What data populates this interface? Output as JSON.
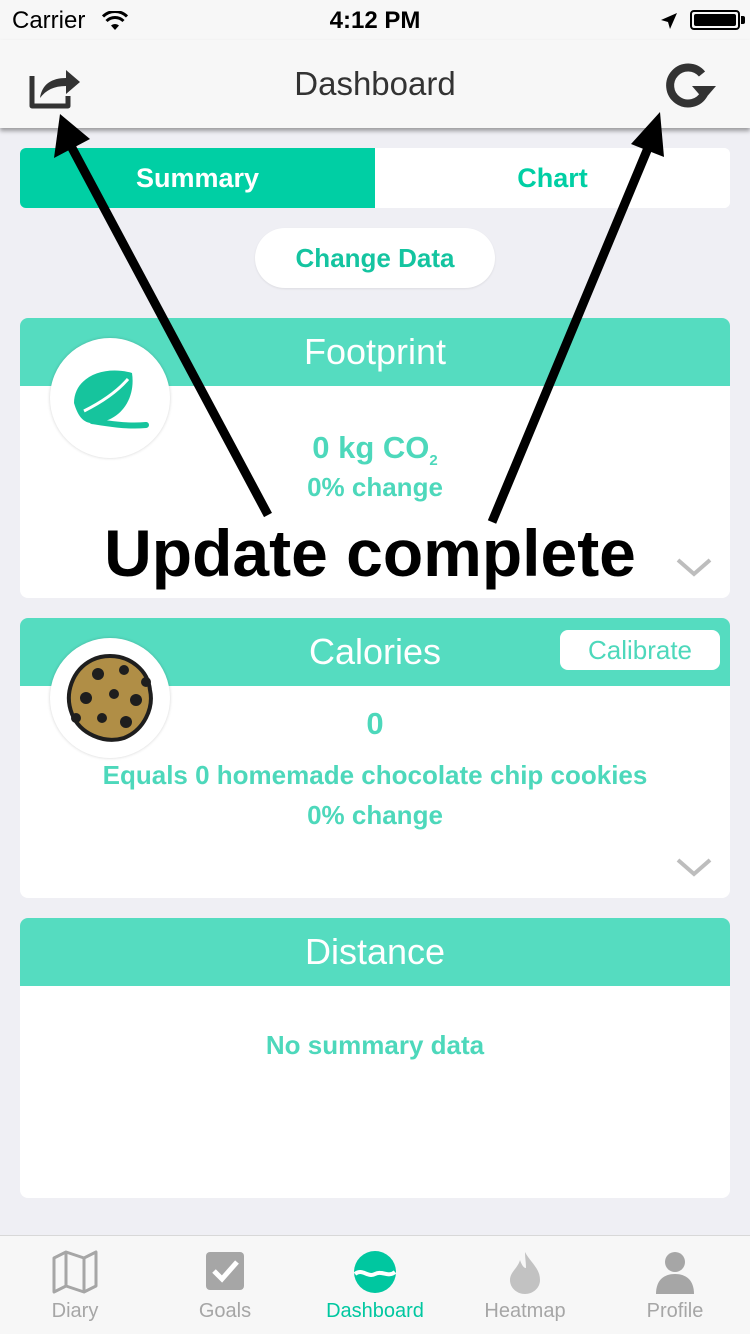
{
  "status_bar": {
    "carrier": "Carrier",
    "time": "4:12 PM"
  },
  "nav": {
    "title": "Dashboard",
    "left_icon": "share-icon",
    "right_icon": "refresh-icon"
  },
  "segmented": {
    "active": "Summary",
    "inactive": "Chart"
  },
  "change_data_label": "Change Data",
  "footprint": {
    "title": "Footprint",
    "value": "0 kg CO",
    "subscript": "2",
    "change": "0% change",
    "icon": "leaf-icon"
  },
  "annotation": "Update complete",
  "calories": {
    "title": "Calories",
    "calibrate": "Calibrate",
    "value": "0",
    "equals": "Equals 0 homemade chocolate chip cookies",
    "change": "0% change",
    "icon": "cookie-icon"
  },
  "distance": {
    "title": "Distance",
    "empty": "No summary data"
  },
  "tabs": [
    {
      "label": "Diary",
      "icon": "map-icon"
    },
    {
      "label": "Goals",
      "icon": "checkbox-icon"
    },
    {
      "label": "Dashboard",
      "icon": "dashboard-icon",
      "active": true
    },
    {
      "label": "Heatmap",
      "icon": "flame-icon"
    },
    {
      "label": "Profile",
      "icon": "person-icon"
    }
  ],
  "colors": {
    "accent": "#00cfa4",
    "header": "#55dcc0",
    "text_accent": "#4dd8bb",
    "inactive_tab": "#a6a6a6"
  }
}
